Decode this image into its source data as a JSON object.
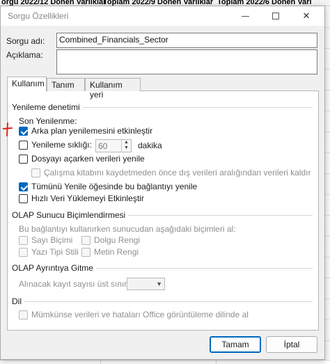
{
  "background": {
    "column_headers": [
      "orgu 2022/12 Donen Varliklar",
      "Toplam 2022/9 Donen Varliklar",
      "Toplam 2022/6 Donen Varl"
    ]
  },
  "dialog": {
    "title": "Sorgu Özellikleri",
    "window_controls": {
      "minimize_icon": "minimize-icon",
      "maximize_icon": "maximize-icon",
      "close_glyph": "✕"
    },
    "query_name_label": "Sorgu adı:",
    "query_name_value": "Combined_Financials_Sector",
    "description_label": "Açıklama:",
    "description_value": "",
    "tabs": [
      "Kullanım",
      "Tanım",
      "Kullanım yeri"
    ],
    "active_tab": "Kullanım",
    "refresh_group": {
      "title": "Yenileme denetimi",
      "last_refresh_label": "Son Yenilenme:",
      "options": {
        "background_refresh": {
          "label": "Arka plan yenilemesini etkinleştir",
          "checked": true,
          "enabled": true
        },
        "refresh_every": {
          "label": "Yenileme sıklığı:",
          "checked": false,
          "enabled": true,
          "value": "60",
          "unit": "dakika"
        },
        "refresh_on_open": {
          "label": "Dosyayı açarken verileri yenile",
          "checked": false,
          "enabled": true
        },
        "remove_data_before_save": {
          "label": "Çalışma kitabını kaydetmeden önce dış verileri aralığından verileri kaldır",
          "checked": false,
          "enabled": false
        },
        "refresh_all": {
          "label": "Tümünü Yenile öğesinde bu bağlantıyı yenile",
          "checked": true,
          "enabled": true
        },
        "fast_load": {
          "label": "Hızlı Veri Yüklemeyi Etkinleştir",
          "checked": false,
          "enabled": true
        }
      }
    },
    "olap_format_group": {
      "title": "OLAP Sunucu Biçimlendirmesi",
      "description": "Bu bağlantıyı kullanırken sunucudan aşağıdaki biçimleri al:",
      "options": {
        "number_format": {
          "label": "Sayı Biçimi",
          "checked": false,
          "enabled": false
        },
        "fill_color": {
          "label": "Dolgu Rengi",
          "checked": false,
          "enabled": false
        },
        "font_style": {
          "label": "Yazı Tipi Stili",
          "checked": false,
          "enabled": false
        },
        "text_color": {
          "label": "Metin Rengi",
          "checked": false,
          "enabled": false
        }
      }
    },
    "olap_drill_group": {
      "title": "OLAP Ayrıntıya Gitme",
      "max_records_label": "Alınacak kayıt sayısı üst sınırı:",
      "max_records_value": ""
    },
    "language_group": {
      "title": "Dil",
      "option": {
        "label": "Mümkünse verileri ve hataları Office görüntüleme dilinde al",
        "checked": false,
        "enabled": false
      }
    },
    "buttons": {
      "ok": "Tamam",
      "cancel": "İptal"
    }
  },
  "colors": {
    "accent": "#0067c0",
    "annotation": "#e0201b",
    "dialog_bg": "#f0f0f0"
  }
}
